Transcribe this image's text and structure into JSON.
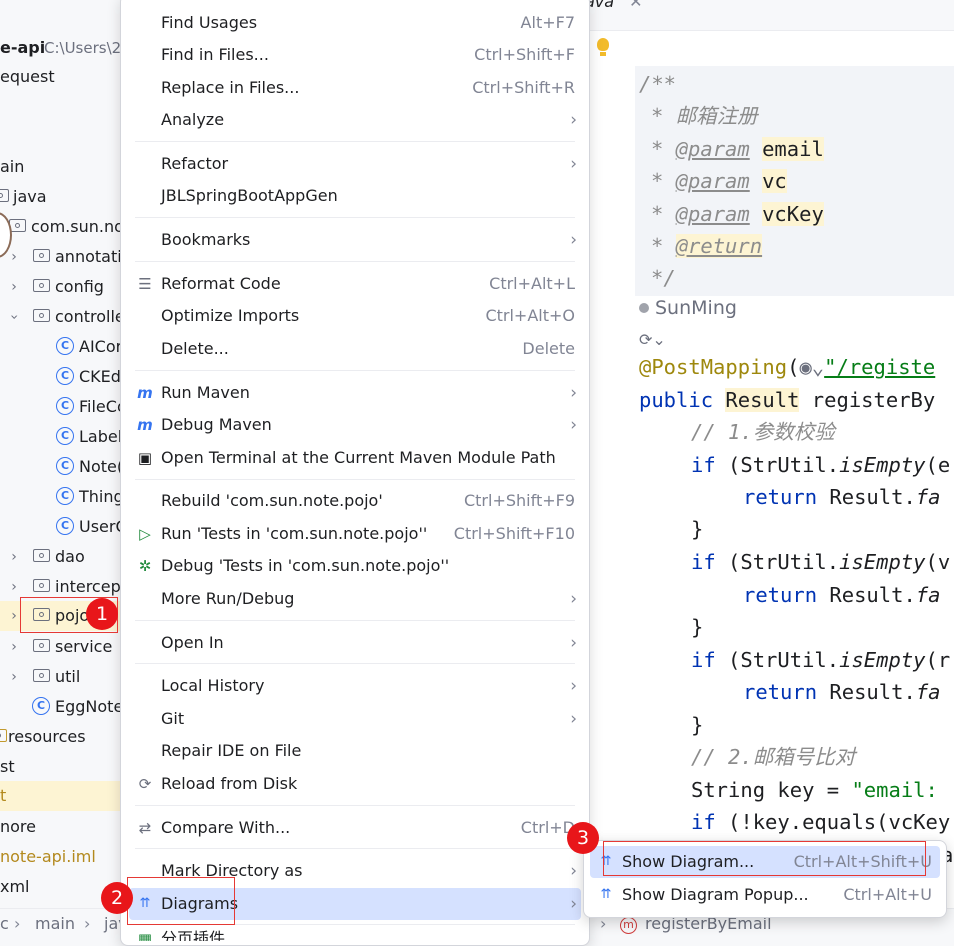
{
  "project_tree": {
    "root_name": "e-api",
    "root_path": "C:\\Users\\2",
    "items": [
      {
        "label": "equest"
      },
      {
        "label": "ain"
      },
      {
        "label": "java"
      },
      {
        "label": "com.sun.no"
      },
      {
        "label": "annotati"
      },
      {
        "label": "config"
      },
      {
        "label": "controlle"
      },
      {
        "label": "AICor"
      },
      {
        "label": "CKEd"
      },
      {
        "label": "FileCo"
      },
      {
        "label": "Label"
      },
      {
        "label": "Note("
      },
      {
        "label": "Thing"
      },
      {
        "label": "UserC"
      },
      {
        "label": "dao"
      },
      {
        "label": "intercept"
      },
      {
        "label": "pojo"
      },
      {
        "label": "service"
      },
      {
        "label": "util"
      },
      {
        "label": "EggNote"
      },
      {
        "label": "resources"
      },
      {
        "label": "st"
      },
      {
        "label": "t"
      },
      {
        "label": "nore"
      },
      {
        "label": "note-api.iml"
      },
      {
        "label": "xml"
      }
    ]
  },
  "editor": {
    "tab_label": "ava",
    "code": {
      "doc_open": "/**",
      "doc_desc": "* 邮箱注册",
      "doc_star": "* ",
      "tag_param": "@param",
      "param1": "email",
      "param2": "vc",
      "param3": "vcKey",
      "tag_return": "@return",
      "doc_close": "*/",
      "author": "SunMing",
      "mapping": "@PostMapping",
      "mapping_str": "\"/registe",
      "kw_public": "public",
      "ret_type": "Result",
      "method": " registerBy",
      "comment1": "// 1.参数校验",
      "kw_if": "if",
      "strutil": " (StrUtil.",
      "isempty": "isEmpty",
      "arg_e": "(e",
      "arg_v": "(v",
      "arg_r": "(r",
      "kw_return": "return",
      "result_fa": " Result.",
      "fa": "fa",
      "brace": "}",
      "comment2": "// 2.邮箱号比对",
      "string_key": "String key = ",
      "email_str": "\"email:",
      "if_key": " (!key.equals(vcKey",
      "trail": "a"
    }
  },
  "breadcrumb": {
    "items": [
      "c",
      "main",
      "jav"
    ],
    "method_name": "registerByEmail",
    "method_icon_letter": "m"
  },
  "context_menu": {
    "items": [
      {
        "label": "Find Usages",
        "shortcut": "Alt+F7"
      },
      {
        "label": "Find in Files...",
        "shortcut": "Ctrl+Shift+F"
      },
      {
        "label": "Replace in Files...",
        "shortcut": "Ctrl+Shift+R"
      },
      {
        "label": "Analyze",
        "sub": "›"
      },
      {
        "label": "Refactor",
        "sub": "›"
      },
      {
        "label": "JBLSpringBootAppGen"
      },
      {
        "label": "Bookmarks",
        "sub": "›"
      },
      {
        "label": "Reformat Code",
        "shortcut": "Ctrl+Alt+L"
      },
      {
        "label": "Optimize Imports",
        "shortcut": "Ctrl+Alt+O"
      },
      {
        "label": "Delete...",
        "shortcut": "Delete"
      },
      {
        "label": "Run Maven",
        "sub": "›"
      },
      {
        "label": "Debug Maven",
        "sub": "›"
      },
      {
        "label": "Open Terminal at the Current Maven Module Path"
      },
      {
        "label": "Rebuild 'com.sun.note.pojo'",
        "shortcut": "Ctrl+Shift+F9"
      },
      {
        "label": "Run 'Tests in 'com.sun.note.pojo''",
        "shortcut": "Ctrl+Shift+F10"
      },
      {
        "label": "Debug 'Tests in 'com.sun.note.pojo''"
      },
      {
        "label": "More Run/Debug",
        "sub": "›"
      },
      {
        "label": "Open In",
        "sub": "›"
      },
      {
        "label": "Local History",
        "sub": "›"
      },
      {
        "label": "Git",
        "sub": "›"
      },
      {
        "label": "Repair IDE on File"
      },
      {
        "label": "Reload from Disk"
      },
      {
        "label": "Compare With...",
        "shortcut": "Ctrl+D"
      },
      {
        "label": "Mark Directory as",
        "sub": "›"
      },
      {
        "label": "Diagrams",
        "sub": "›"
      },
      {
        "label": "分页插件"
      }
    ]
  },
  "submenu": {
    "items": [
      {
        "label": "Show Diagram...",
        "shortcut": "Ctrl+Alt+Shift+U"
      },
      {
        "label": "Show Diagram Popup...",
        "shortcut": "Ctrl+Alt+U"
      }
    ]
  },
  "annotations": {
    "badge1": "1",
    "badge2": "2",
    "badge3": "3",
    "color": "#e8161a"
  },
  "colors": {
    "menu_hover": "#d5e1ff",
    "selection": "#fdf4d3",
    "keyword": "#0033b3",
    "string": "#067d17",
    "annotation": "#9e880d"
  }
}
